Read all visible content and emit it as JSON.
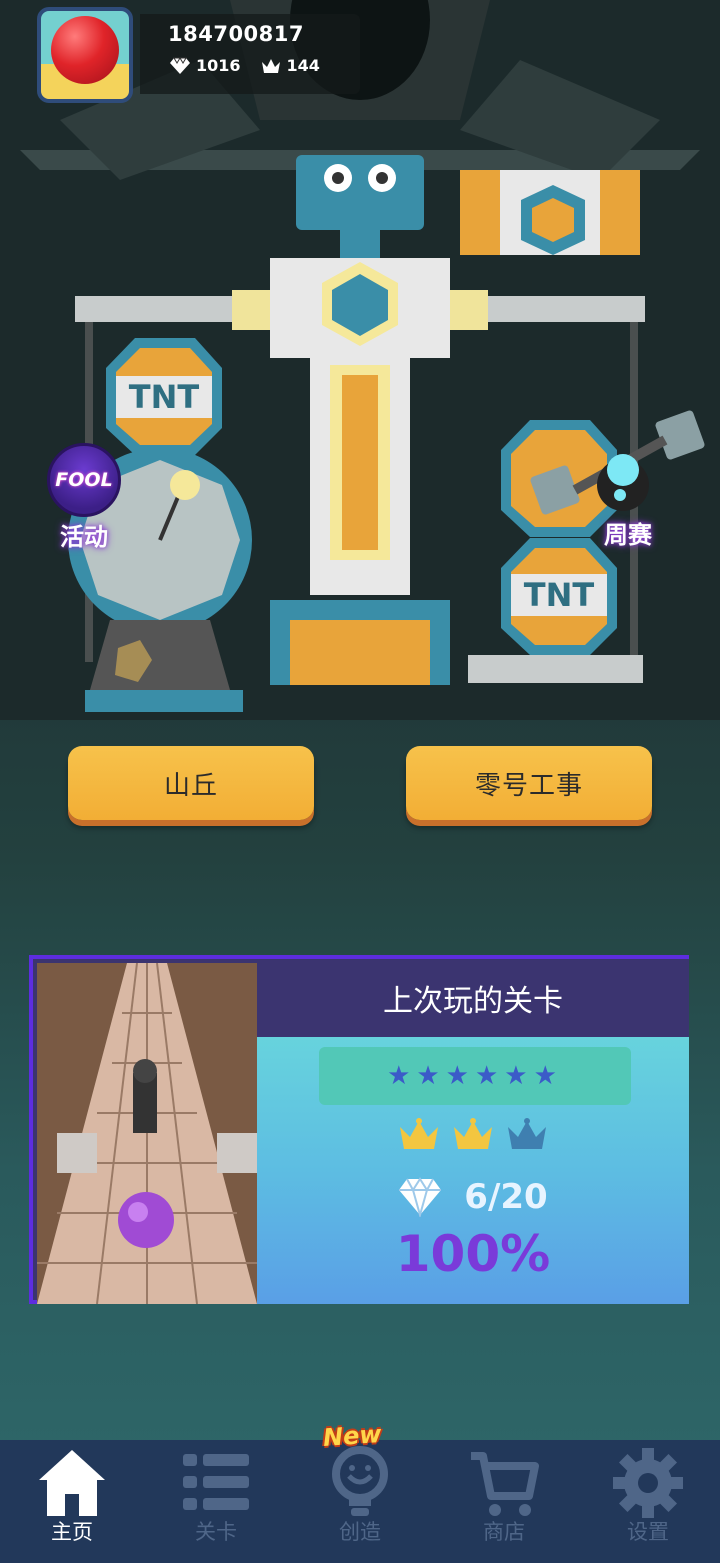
{
  "profile": {
    "user_id": "184700817",
    "diamonds": "1016",
    "crowns": "144"
  },
  "side_buttons": {
    "event_badge": "FOOL",
    "event_label": "活动",
    "weekly_label": "周赛"
  },
  "scene_signs": [
    "TNT",
    "TNT",
    "TNT"
  ],
  "mode_buttons": {
    "left": "山丘",
    "right": "零号工事"
  },
  "last_played": {
    "title": "上次玩的关卡",
    "stars_total": 6,
    "stars": "★★★★★★",
    "crowns_earned": 2,
    "crowns_total": 3,
    "gems": "6/20",
    "progress": "100%"
  },
  "nav": {
    "items": [
      {
        "label": "主页",
        "icon": "home-icon",
        "active": true
      },
      {
        "label": "关卡",
        "icon": "list-icon",
        "active": false
      },
      {
        "label": "创造",
        "icon": "lightbulb-icon",
        "active": false
      },
      {
        "label": "商店",
        "icon": "cart-icon",
        "active": false
      },
      {
        "label": "设置",
        "icon": "gear-icon",
        "active": false
      }
    ],
    "new_badge": "New"
  },
  "colors": {
    "button": "#f2ae35",
    "card_border": "#5d2de0",
    "percent": "#7a3ad9",
    "nav_bg": "#22385a"
  }
}
